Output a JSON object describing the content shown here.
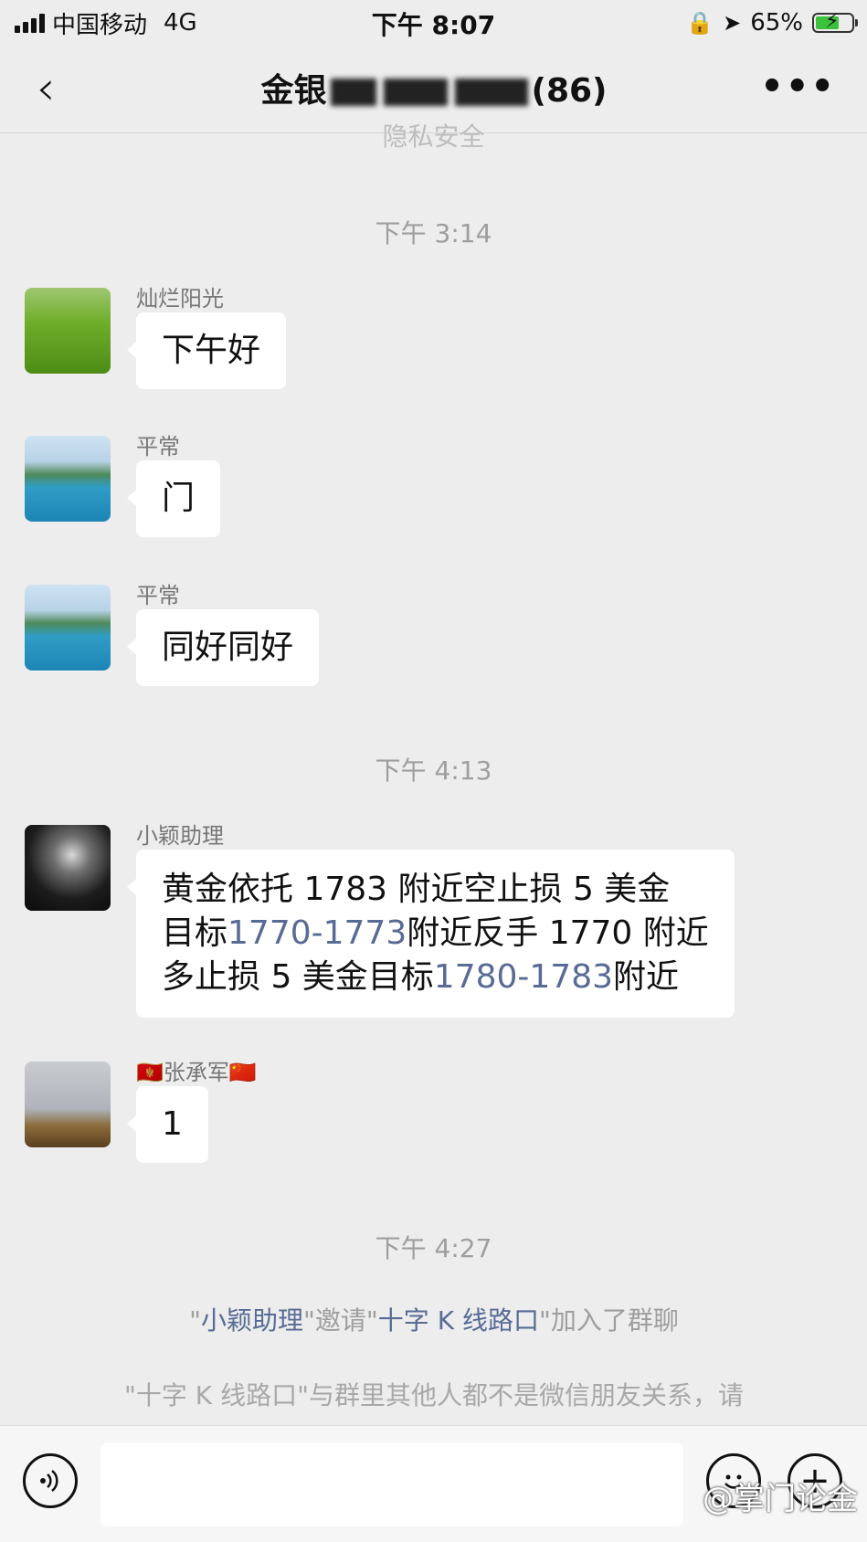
{
  "status_bar": {
    "carrier": "中国移动",
    "network": "4G",
    "time": "下午 8:07",
    "battery": "65%",
    "battery_level": 0.65,
    "icons": [
      "signal-icon",
      "rotation-lock-icon",
      "location-icon",
      "battery-icon"
    ]
  },
  "nav": {
    "title_visible_start": "金银",
    "title_visible_end": "(86)",
    "back_icon": "chevron-left-icon",
    "more_icon": "more-icon"
  },
  "chat": {
    "privacy_notice": "隐私安全",
    "times": [
      "下午 3:14",
      "下午 4:13",
      "下午 4:27"
    ],
    "messages": [
      {
        "sender": "灿烂阳光",
        "text": "下午好"
      },
      {
        "sender": "平常",
        "text": "门"
      },
      {
        "sender": "平常",
        "text": "同好同好"
      },
      {
        "sender": "小颖助理",
        "lines": [
          {
            "pre": "黄金依托 1783 附近空止损 5 美金",
            "link": "",
            "post": ""
          },
          {
            "pre": "目标",
            "link": "1770-1773",
            "post": "附近反手 1770 附近"
          },
          {
            "pre": "多止损 5 美金目标",
            "link": "1780-1783",
            "post": "附近"
          }
        ]
      },
      {
        "sender": "张承军",
        "sender_flag_left": "🇲🇪",
        "sender_flag_right": "🇨🇳",
        "text": "1"
      }
    ],
    "system": {
      "invite": {
        "q1": "\"",
        "user1": "小颖助理",
        "mid": "\"邀请\"",
        "user2": "十字 K 线路口",
        "end": "\"加入了群聊"
      },
      "notice": "\"十字 K 线路口\"与群里其他人都不是微信朋友关系，请"
    }
  },
  "input_bar": {
    "voice_icon": "voice-icon",
    "emoji_icon": "emoji-icon",
    "add_icon": "add-icon",
    "watermark": "@掌门论金"
  },
  "colors": {
    "background": "#ededed",
    "bubble": "#ffffff",
    "link": "#576b95",
    "timestamp": "#9e9e9e",
    "battery_green": "#3cc13c"
  }
}
